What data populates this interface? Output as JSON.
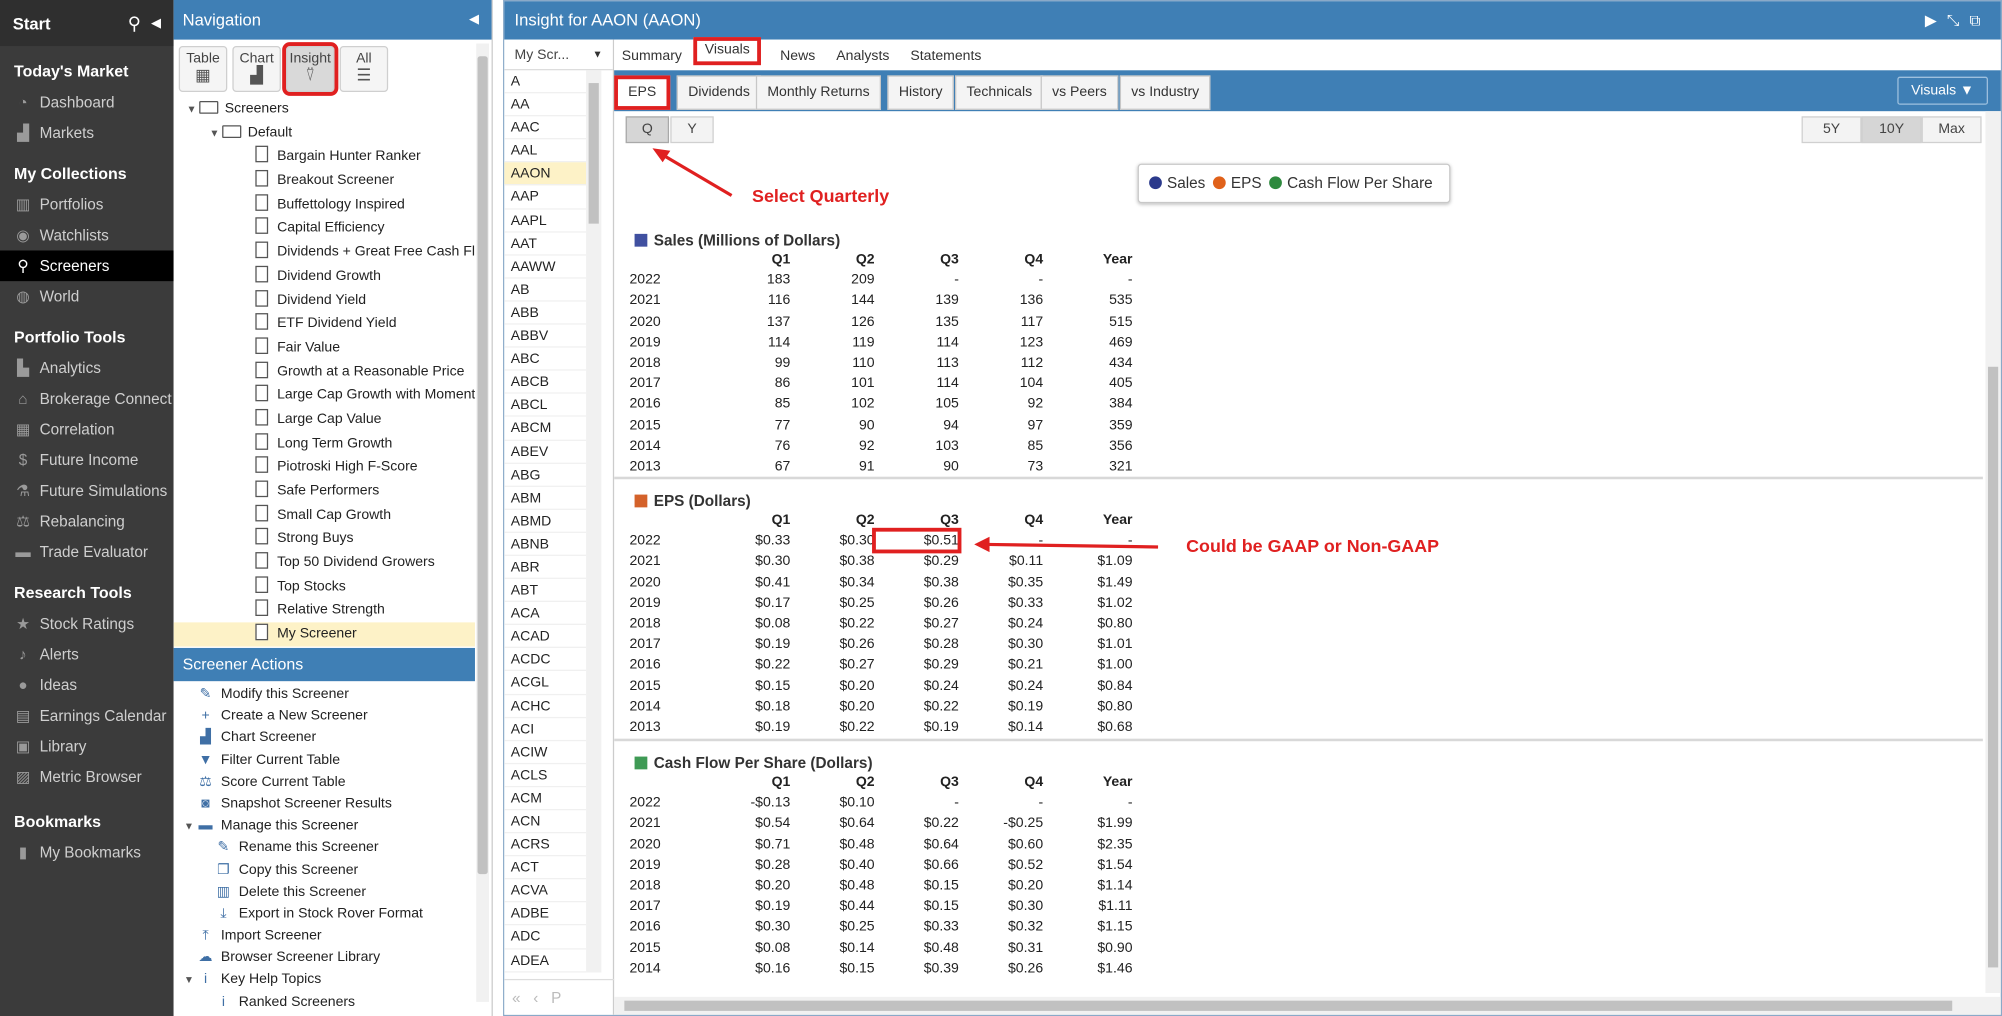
{
  "sidebar": {
    "start_label": "Start",
    "sections": [
      {
        "title": "Today's Market",
        "items": [
          {
            "label": "Dashboard",
            "icon": "dashboard-icon",
            "glyph": "◔"
          },
          {
            "label": "Markets",
            "icon": "markets-icon",
            "glyph": "▟"
          }
        ]
      },
      {
        "title": "My Collections",
        "items": [
          {
            "label": "Portfolios",
            "icon": "portfolios-icon",
            "glyph": "▥"
          },
          {
            "label": "Watchlists",
            "icon": "watchlists-icon",
            "glyph": "◉"
          },
          {
            "label": "Screeners",
            "icon": "search-icon",
            "glyph": "⚲",
            "active": true
          },
          {
            "label": "World",
            "icon": "globe-icon",
            "glyph": "◍"
          }
        ]
      },
      {
        "title": "Portfolio Tools",
        "items": [
          {
            "label": "Analytics",
            "icon": "analytics-icon",
            "glyph": "▙"
          },
          {
            "label": "Brokerage Connect",
            "icon": "bank-icon",
            "glyph": "⌂"
          },
          {
            "label": "Correlation",
            "icon": "grid-icon",
            "glyph": "▦"
          },
          {
            "label": "Future Income",
            "icon": "dollar-icon",
            "glyph": "$"
          },
          {
            "label": "Future Simulations",
            "icon": "flask-icon",
            "glyph": "⚗"
          },
          {
            "label": "Rebalancing",
            "icon": "scale-icon",
            "glyph": "⚖"
          },
          {
            "label": "Trade Evaluator",
            "icon": "briefcase-icon",
            "glyph": "▬"
          }
        ]
      },
      {
        "title": "Research Tools",
        "items": [
          {
            "label": "Stock Ratings",
            "icon": "star-icon",
            "glyph": "★"
          },
          {
            "label": "Alerts",
            "icon": "bell-icon",
            "glyph": "♪"
          },
          {
            "label": "Ideas",
            "icon": "lightbulb-icon",
            "glyph": "●"
          },
          {
            "label": "Earnings Calendar",
            "icon": "calendar-icon",
            "glyph": "▤"
          },
          {
            "label": "Library",
            "icon": "library-icon",
            "glyph": "▣"
          },
          {
            "label": "Metric Browser",
            "icon": "metric-browser-icon",
            "glyph": "▨"
          }
        ]
      },
      {
        "title": "Bookmarks",
        "items": [
          {
            "label": "My Bookmarks",
            "icon": "bookmark-icon",
            "glyph": "▮"
          }
        ]
      }
    ]
  },
  "navigation": {
    "title": "Navigation",
    "view_buttons": [
      {
        "label": "Table",
        "glyph": "▦"
      },
      {
        "label": "Chart",
        "glyph": "▟"
      },
      {
        "label": "Insight",
        "glyph": "⍢",
        "selected": true
      },
      {
        "label": "All",
        "glyph": "☰"
      }
    ],
    "tree_root": "Screeners",
    "tree_folder": "Default",
    "screeners": [
      "Bargain Hunter Ranker",
      "Breakout Screener",
      "Buffettology Inspired",
      "Capital Efficiency",
      "Dividends + Great Free Cash Flow",
      "Dividend Growth",
      "Dividend Yield",
      "ETF Dividend Yield",
      "Fair Value",
      "Growth at a Reasonable Price",
      "Large Cap Growth with Momentum",
      "Large Cap Value",
      "Long Term Growth",
      "Piotroski High F-Score",
      "Safe Performers",
      "Small Cap Growth",
      "Strong Buys",
      "Top 50 Dividend Growers",
      "Top Stocks",
      "Relative Strength",
      "My Screener"
    ],
    "selected_screener": "My Screener"
  },
  "screener_actions": {
    "title": "Screener Actions",
    "items": [
      {
        "label": "Modify this Screener",
        "glyph": "✎",
        "icon": "edit-icon",
        "indent": 1
      },
      {
        "label": "Create a New Screener",
        "glyph": "+",
        "icon": "add-icon",
        "indent": 1
      },
      {
        "label": "Chart Screener",
        "glyph": "▟",
        "icon": "chart-icon",
        "indent": 1
      },
      {
        "label": "Filter Current Table",
        "glyph": "▼",
        "icon": "filter-icon",
        "indent": 1
      },
      {
        "label": "Score Current Table",
        "glyph": "⚖",
        "icon": "score-icon",
        "indent": 1
      },
      {
        "label": "Snapshot Screener Results",
        "glyph": "◙",
        "icon": "camera-icon",
        "indent": 1
      },
      {
        "label": "Manage this Screener",
        "glyph": "▬",
        "icon": "folder-icon",
        "indent": 0,
        "toggle": "▼"
      },
      {
        "label": "Rename this Screener",
        "glyph": "✎",
        "icon": "rename-icon",
        "indent": 2
      },
      {
        "label": "Copy this Screener",
        "glyph": "❐",
        "icon": "copy-icon",
        "indent": 2
      },
      {
        "label": "Delete this Screener",
        "glyph": "▥",
        "icon": "trash-icon",
        "indent": 2
      },
      {
        "label": "Export in Stock Rover Format",
        "glyph": "⤓",
        "icon": "export-icon",
        "indent": 2
      },
      {
        "label": "Import Screener",
        "glyph": "⤒",
        "icon": "import-icon",
        "indent": 1
      },
      {
        "label": "Browser Screener Library",
        "glyph": "☁",
        "icon": "cloud-icon",
        "indent": 1
      },
      {
        "label": "Key Help Topics",
        "glyph": "i",
        "icon": "info-icon",
        "indent": 0,
        "toggle": "▼"
      },
      {
        "label": "Ranked Screeners",
        "glyph": "i",
        "icon": "help-topic-icon",
        "indent": 2
      }
    ]
  },
  "insight": {
    "title": "Insight for AAON (AAON)",
    "tickers_header": "My Scr...",
    "tickers": [
      "A",
      "AA",
      "AAC",
      "AAL",
      "AAON",
      "AAP",
      "AAPL",
      "AAT",
      "AAWW",
      "AB",
      "ABB",
      "ABBV",
      "ABC",
      "ABCB",
      "ABCL",
      "ABCM",
      "ABEV",
      "ABG",
      "ABM",
      "ABMD",
      "ABNB",
      "ABR",
      "ABT",
      "ACA",
      "ACAD",
      "ACDC",
      "ACGL",
      "ACHC",
      "ACI",
      "ACIW",
      "ACLS",
      "ACM",
      "ACN",
      "ACRS",
      "ACT",
      "ACVA",
      "ADBE",
      "ADC",
      "ADEA"
    ],
    "selected_ticker": "AAON",
    "footer_glyphs": "«‹P",
    "tabs1": [
      {
        "label": "Summary"
      },
      {
        "label": "Visuals",
        "selected": true
      },
      {
        "label": "News"
      },
      {
        "label": "Analysts"
      },
      {
        "label": "Statements"
      }
    ],
    "tabs2": [
      {
        "label": "EPS",
        "selected": true
      },
      {
        "label": "Dividends"
      },
      {
        "label": "Monthly Returns"
      },
      {
        "label": "History"
      },
      {
        "label": "Technicals"
      },
      {
        "label": "vs Peers"
      },
      {
        "label": "vs Industry"
      }
    ],
    "visuals_dropdown": "Visuals ▼",
    "period_buttons": [
      {
        "label": "Q",
        "selected": true
      },
      {
        "label": "Y"
      }
    ],
    "range_buttons": [
      {
        "label": "5Y"
      },
      {
        "label": "10Y",
        "selected": true
      },
      {
        "label": "Max"
      }
    ],
    "legend": [
      {
        "label": "Sales",
        "color": "#2b3a8c"
      },
      {
        "label": "EPS",
        "color": "#e0611a"
      },
      {
        "label": "Cash Flow Per Share",
        "color": "#2e8a3e"
      }
    ],
    "annotations": {
      "quarterly": "Select Quarterly",
      "gaap": "Could be GAAP or Non-GAAP"
    }
  },
  "tables": [
    {
      "title": "Sales (Millions of Dollars)",
      "color": "#4050a0",
      "headers": [
        "",
        "Q1",
        "Q2",
        "Q3",
        "Q4",
        "Year"
      ],
      "rows": [
        [
          "2022",
          "183",
          "209",
          "-",
          "-",
          "-"
        ],
        [
          "2021",
          "116",
          "144",
          "139",
          "136",
          "535"
        ],
        [
          "2020",
          "137",
          "126",
          "135",
          "117",
          "515"
        ],
        [
          "2019",
          "114",
          "119",
          "114",
          "123",
          "469"
        ],
        [
          "2018",
          "99",
          "110",
          "113",
          "112",
          "434"
        ],
        [
          "2017",
          "86",
          "101",
          "114",
          "104",
          "405"
        ],
        [
          "2016",
          "85",
          "102",
          "105",
          "92",
          "384"
        ],
        [
          "2015",
          "77",
          "90",
          "94",
          "97",
          "359"
        ],
        [
          "2014",
          "76",
          "92",
          "103",
          "85",
          "356"
        ],
        [
          "2013",
          "67",
          "91",
          "90",
          "73",
          "321"
        ]
      ]
    },
    {
      "title": "EPS (Dollars)",
      "color": "#d4622a",
      "headers": [
        "",
        "Q1",
        "Q2",
        "Q3",
        "Q4",
        "Year"
      ],
      "rows": [
        [
          "2022",
          "$0.33",
          "$0.30",
          "$0.51",
          "-",
          "-"
        ],
        [
          "2021",
          "$0.30",
          "$0.38",
          "$0.29",
          "$0.11",
          "$1.09"
        ],
        [
          "2020",
          "$0.41",
          "$0.34",
          "$0.38",
          "$0.35",
          "$1.49"
        ],
        [
          "2019",
          "$0.17",
          "$0.25",
          "$0.26",
          "$0.33",
          "$1.02"
        ],
        [
          "2018",
          "$0.08",
          "$0.22",
          "$0.27",
          "$0.24",
          "$0.80"
        ],
        [
          "2017",
          "$0.19",
          "$0.26",
          "$0.28",
          "$0.30",
          "$1.01"
        ],
        [
          "2016",
          "$0.22",
          "$0.27",
          "$0.29",
          "$0.21",
          "$1.00"
        ],
        [
          "2015",
          "$0.15",
          "$0.20",
          "$0.24",
          "$0.24",
          "$0.84"
        ],
        [
          "2014",
          "$0.18",
          "$0.20",
          "$0.22",
          "$0.19",
          "$0.80"
        ],
        [
          "2013",
          "$0.19",
          "$0.22",
          "$0.19",
          "$0.14",
          "$0.68"
        ]
      ]
    },
    {
      "title": "Cash Flow Per Share (Dollars)",
      "color": "#3f9a55",
      "headers": [
        "",
        "Q1",
        "Q2",
        "Q3",
        "Q4",
        "Year"
      ],
      "rows": [
        [
          "2022",
          "-$0.13",
          "$0.10",
          "-",
          "-",
          "-"
        ],
        [
          "2021",
          "$0.54",
          "$0.64",
          "$0.22",
          "-$0.25",
          "$1.99"
        ],
        [
          "2020",
          "$0.71",
          "$0.48",
          "$0.64",
          "$0.60",
          "$2.35"
        ],
        [
          "2019",
          "$0.28",
          "$0.40",
          "$0.66",
          "$0.52",
          "$1.54"
        ],
        [
          "2018",
          "$0.20",
          "$0.48",
          "$0.15",
          "$0.20",
          "$1.14"
        ],
        [
          "2017",
          "$0.19",
          "$0.44",
          "$0.15",
          "$0.30",
          "$1.11"
        ],
        [
          "2016",
          "$0.30",
          "$0.25",
          "$0.33",
          "$0.32",
          "$1.15"
        ],
        [
          "2015",
          "$0.08",
          "$0.14",
          "$0.48",
          "$0.31",
          "$0.90"
        ],
        [
          "2014",
          "$0.16",
          "$0.15",
          "$0.39",
          "$0.26",
          "$1.46"
        ]
      ]
    }
  ]
}
